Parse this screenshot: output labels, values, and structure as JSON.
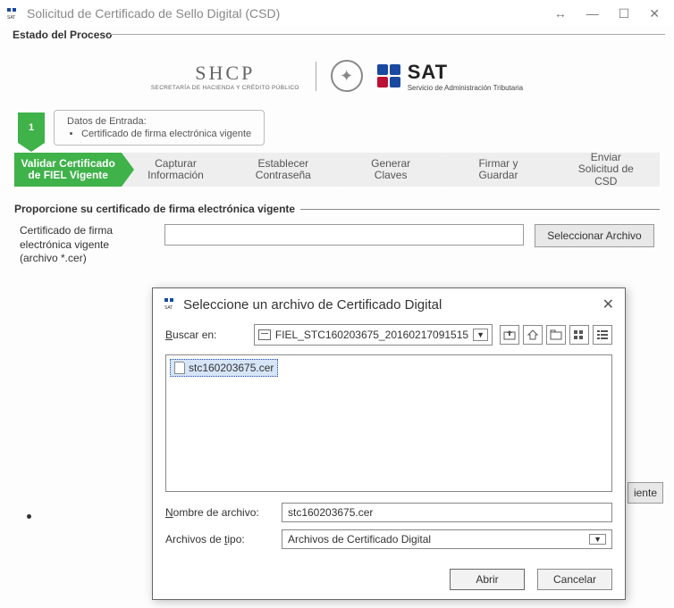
{
  "window": {
    "title": "Solicitud de Certificado de Sello Digital (CSD)"
  },
  "process": {
    "legend": "Estado del Proceso",
    "step_number": "1",
    "entry_title": "Datos de Entrada:",
    "entry_item": "Certificado de firma electrónica vigente"
  },
  "logos": {
    "shcp_main": "SHCP",
    "shcp_sub": "SECRETARÍA DE HACIENDA Y CRÉDITO PÚBLICO",
    "sat_main": "SAT",
    "sat_sub": "Servicio de Administración Tributaria"
  },
  "wizard": {
    "steps": [
      {
        "l1": "Validar Certificado",
        "l2": "de FIEL Vigente"
      },
      {
        "l1": "Capturar",
        "l2": "Información"
      },
      {
        "l1": "Establecer",
        "l2": "Contraseña"
      },
      {
        "l1": "Generar",
        "l2": "Claves"
      },
      {
        "l1": "Firmar y",
        "l2": "Guardar"
      },
      {
        "l1": "Enviar",
        "l2": "Solicitud de",
        "l3": "CSD"
      }
    ]
  },
  "section": {
    "heading": "Proporcione su certificado de firma electrónica vigente",
    "cert_label_l1": "Certificado de firma",
    "cert_label_l2": "electrónica vigente",
    "cert_label_l3": "(archivo *.cer)",
    "cert_value": "",
    "select_btn": "Seleccionar Archivo",
    "next_btn_partial": "iente"
  },
  "dialog": {
    "title": "Seleccione un archivo de Certificado Digital",
    "search_in_label": "Buscar en:",
    "search_in_value": "FIEL_STC160203675_20160217091515",
    "file_selected": "stc160203675.cer",
    "filename_label": "Nombre de archivo:",
    "filename_value": "stc160203675.cer",
    "filetype_label": "Archivos de tipo:",
    "filetype_value": "Archivos de Certificado Digital",
    "open_btn": "Abrir",
    "cancel_btn": "Cancelar"
  }
}
